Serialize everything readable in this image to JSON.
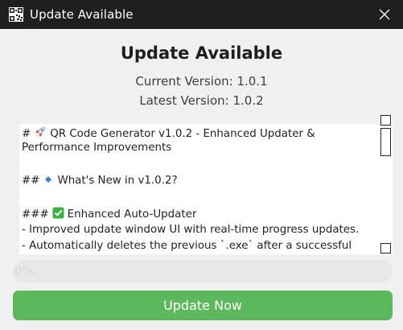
{
  "window": {
    "title": "Update Available",
    "app_icon": "qr-code-icon",
    "close_icon": "close-icon"
  },
  "header": {
    "heading": "Update Available",
    "current_version": "Current Version: 1.0.1",
    "latest_version": "Latest Version: 1.0.2"
  },
  "notes": {
    "line1_prefix": "#",
    "line1_emoji": "rocket-icon",
    "line1_text": "QR Code Generator v1.0.2 - Enhanced Updater &",
    "line2_text": "Performance Improvements",
    "line3_prefix": "##",
    "line3_emoji": "blue-diamond-icon",
    "line3_text": "What's New in v1.0.2?",
    "line4_prefix": "###",
    "line4_emoji": "check-mark-icon",
    "line4_text": "Enhanced Auto-Updater",
    "line5_text": "- Improved update window UI with real-time progress updates.",
    "line6_text": "- Automatically deletes the previous `.exe` after a successful"
  },
  "progress": {
    "value": 0,
    "label": "0%"
  },
  "actions": {
    "update_label": "Update Now"
  },
  "colors": {
    "titlebar": "#1f1f1f",
    "accent_green": "#5cb85c",
    "background": "#f0f0f0"
  }
}
